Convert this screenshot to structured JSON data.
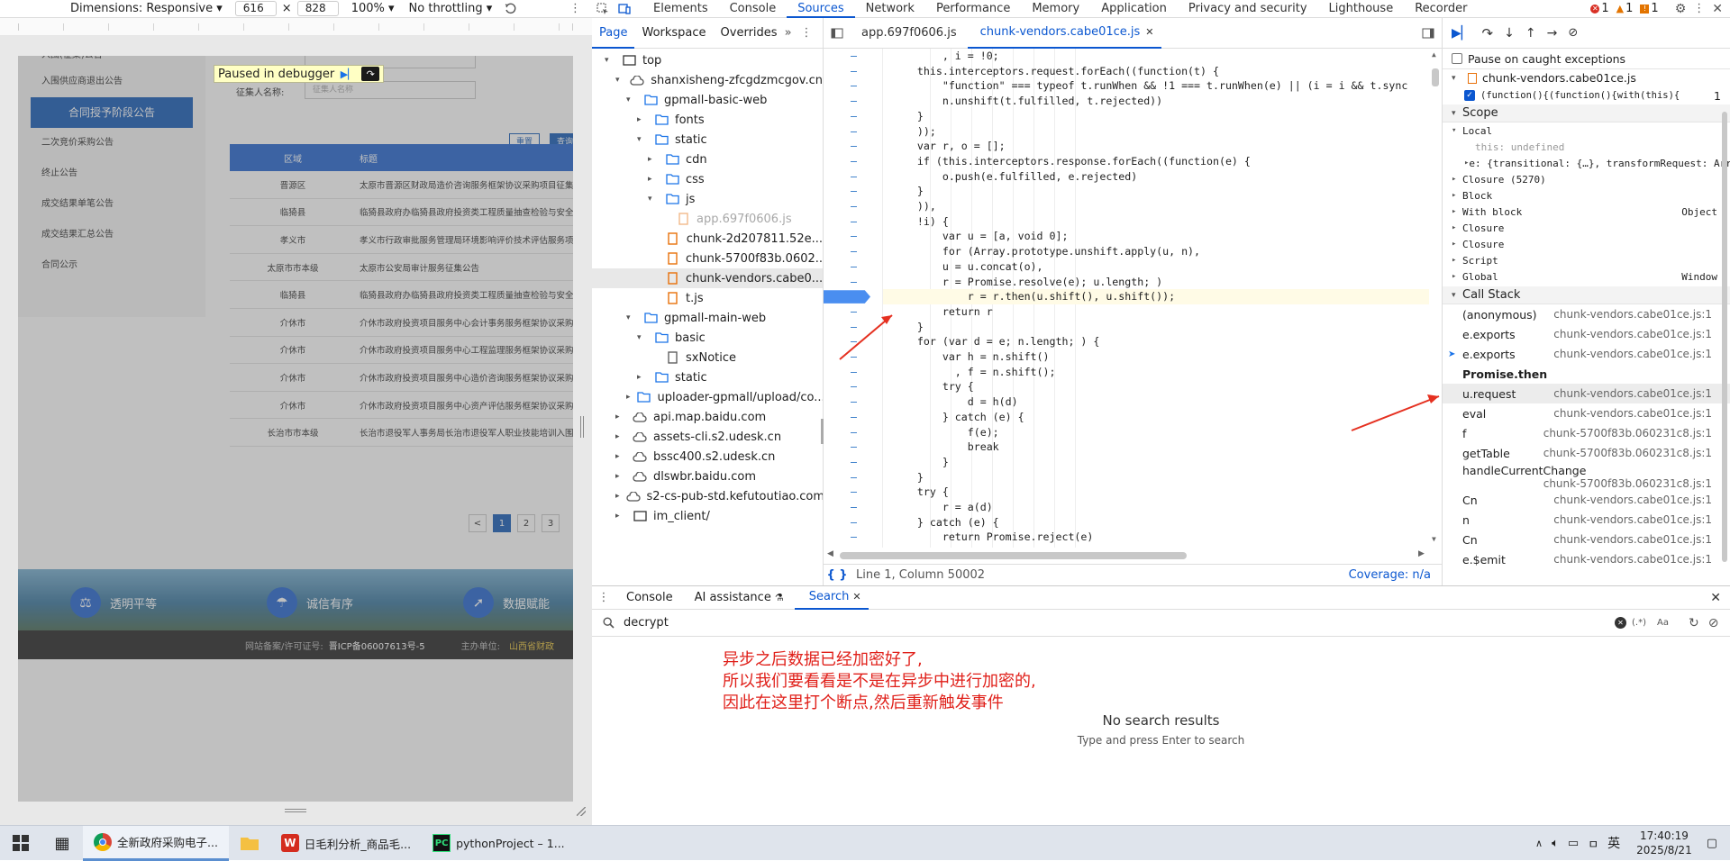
{
  "device_toolbar": {
    "dimensions_label": "Dimensions: Responsive ▾",
    "width": "616",
    "times": "×",
    "height": "828",
    "zoom": "100% ▾",
    "throttle": "No throttling ▾"
  },
  "page": {
    "paused_label": "Paused in debugger",
    "form_label": "征集人名称:",
    "form_placeholder": "征集人名称",
    "reset_btn": "重置",
    "search_btn": "查询",
    "menu": [
      "入围供应商退出公告",
      "合同授予阶段公告",
      "二次竞价采购公告",
      "终止公告",
      "成交结果单笔公告",
      "成交结果汇总公告",
      "合同公示"
    ],
    "menu_active_index": 1,
    "menu_top_partial": "入围(征集)公告",
    "table_head": {
      "region": "区域",
      "title": "标题"
    },
    "table_rows": [
      {
        "region": "晋源区",
        "title": "太原市晋源区财政局造价咨询服务框架协议采购项目征集"
      },
      {
        "region": "临猗县",
        "title": "临猗县政府办临猗县政府投资类工程质量抽查检验与安全"
      },
      {
        "region": "孝义市",
        "title": "孝义市行政审批服务管理局环境影响评价技术评估服务项"
      },
      {
        "region": "太原市市本级",
        "title": "太原市公安局审计服务征集公告"
      },
      {
        "region": "临猗县",
        "title": "临猗县政府办临猗县政府投资类工程质量抽查检验与安全"
      },
      {
        "region": "介休市",
        "title": "介休市政府投资项目服务中心会计事务服务框架协议采购"
      },
      {
        "region": "介休市",
        "title": "介休市政府投资项目服务中心工程监理服务框架协议采购"
      },
      {
        "region": "介休市",
        "title": "介休市政府投资项目服务中心造价咨询服务框架协议采购"
      },
      {
        "region": "介休市",
        "title": "介休市政府投资项目服务中心资产评估服务框架协议采购"
      },
      {
        "region": "长治市市本级",
        "title": "长治市退役军人事务局长治市退役军人职业技能培训入围"
      }
    ],
    "pager": [
      "<",
      "1",
      "2",
      "3"
    ],
    "pager_active": "1",
    "banner": [
      "透明平等",
      "诚信有序",
      "数据赋能"
    ],
    "footer_record": "网站备案/许可证号:",
    "footer_icp": "晋ICP备06007613号-5",
    "footer_host": "主办单位:",
    "footer_host_name": "山西省财政"
  },
  "devtools": {
    "tabs": [
      "Elements",
      "Console",
      "Sources",
      "Network",
      "Performance",
      "Memory",
      "Application",
      "Privacy and security",
      "Lighthouse",
      "Recorder"
    ],
    "active_tab": "Sources",
    "badges": {
      "errors": "1",
      "warnings": "1",
      "issues": "1"
    },
    "nav_tabs": [
      "Page",
      "Workspace",
      "Overrides"
    ],
    "tree": [
      {
        "depth": 0,
        "arrow": "▾",
        "icon": "frame",
        "label": "top"
      },
      {
        "depth": 1,
        "arrow": "▾",
        "icon": "cloud",
        "label": "shanxisheng-zfcgdzmcgov.cn"
      },
      {
        "depth": 2,
        "arrow": "▾",
        "icon": "folder",
        "label": "gpmall-basic-web"
      },
      {
        "depth": 3,
        "arrow": "▸",
        "icon": "folder",
        "label": "fonts"
      },
      {
        "depth": 3,
        "arrow": "▾",
        "icon": "folder",
        "label": "static"
      },
      {
        "depth": 4,
        "arrow": "▸",
        "icon": "folder",
        "label": "cdn"
      },
      {
        "depth": 4,
        "arrow": "▸",
        "icon": "folder",
        "label": "css"
      },
      {
        "depth": 4,
        "arrow": "▾",
        "icon": "folder",
        "label": "js"
      },
      {
        "depth": 5,
        "arrow": "",
        "icon": "file-dim",
        "label": "app.697f0606.js"
      },
      {
        "depth": 5,
        "arrow": "",
        "icon": "file",
        "label": "chunk-2d207811.52e..."
      },
      {
        "depth": 5,
        "arrow": "",
        "icon": "file",
        "label": "chunk-5700f83b.0602..."
      },
      {
        "depth": 5,
        "arrow": "",
        "icon": "file",
        "label": "chunk-vendors.cabe0..."
      },
      {
        "depth": 4,
        "arrow": "",
        "icon": "file",
        "label": "t.js"
      },
      {
        "depth": 2,
        "arrow": "▾",
        "icon": "folder",
        "label": "gpmall-main-web"
      },
      {
        "depth": 3,
        "arrow": "▾",
        "icon": "folder",
        "label": "basic"
      },
      {
        "depth": 4,
        "arrow": "",
        "icon": "doc",
        "label": "sxNotice"
      },
      {
        "depth": 3,
        "arrow": "▸",
        "icon": "folder",
        "label": "static"
      },
      {
        "depth": 2,
        "arrow": "▸",
        "icon": "folder",
        "label": "uploader-gpmall/upload/co..."
      },
      {
        "depth": 1,
        "arrow": "▸",
        "icon": "cloud",
        "label": "api.map.baidu.com"
      },
      {
        "depth": 1,
        "arrow": "▸",
        "icon": "cloud",
        "label": "assets-cli.s2.udesk.cn"
      },
      {
        "depth": 1,
        "arrow": "▸",
        "icon": "cloud",
        "label": "bssc400.s2.udesk.cn"
      },
      {
        "depth": 1,
        "arrow": "▸",
        "icon": "cloud",
        "label": "dlswbr.baidu.com"
      },
      {
        "depth": 1,
        "arrow": "▸",
        "icon": "cloud",
        "label": "s2-cs-pub-std.kefutoutiao.com"
      },
      {
        "depth": 1,
        "arrow": "▸",
        "icon": "frame",
        "label": "im_client/"
      }
    ],
    "selected_tree_index": 11,
    "editor_tabs": [
      "app.697f0606.js",
      "chunk-vendors.cabe01ce.js"
    ],
    "active_editor_tab": 1,
    "code_lines": [
      "        , i = !0;",
      "    this.interceptors.request.forEach((function(t) {",
      "        \"function\" === typeof t.runWhen && !1 === t.runWhen(e) || (i = i && t.sync",
      "        n.unshift(t.fulfilled, t.rejected))",
      "    }",
      "    ));",
      "    var r, o = [];",
      "    if (this.interceptors.response.forEach((function(e) {",
      "        o.push(e.fulfilled, e.rejected)",
      "    }",
      "    )),",
      "    !i) {",
      "        var u = [a, void 0];",
      "        for (Array.prototype.unshift.apply(u, n),",
      "        u = u.concat(o),",
      "        r = Promise.resolve(e); u.length; )",
      "            r = r.then(u.shift(), u.shift());",
      "        return r",
      "    }",
      "    for (var d = e; n.length; ) {",
      "        var h = n.shift()",
      "          , f = n.shift();",
      "        try {",
      "            d = h(d)",
      "        } catch (e) {",
      "            f(e);",
      "            break",
      "        }",
      "    }",
      "    try {",
      "        r = a(d)",
      "    } catch (e) {",
      "        return Promise.reject(e)"
    ],
    "breakpoint_line_index": 16,
    "status": {
      "position": "Line 1, Column 50002",
      "coverage": "Coverage: n/a"
    },
    "pause_on_caught": "Pause on caught exceptions",
    "breakpoint_file": "chunk-vendors.cabe01ce.js",
    "breakpoint_snippet": "(function(){(function(){with(this){",
    "breakpoint_line_no": "1",
    "scope_title": "Scope",
    "scope_rows": [
      {
        "indent": 0,
        "arrow": "▾",
        "name": "Local",
        "value": ""
      },
      {
        "indent": 1,
        "arrow": "",
        "name": "this: undefined",
        "value": ""
      },
      {
        "indent": 1,
        "arrow": "▸",
        "name": "e: {transitional: {…}, transformRequest: Arra",
        "value": ""
      },
      {
        "indent": 0,
        "arrow": "▸",
        "name": "Closure (5270)",
        "value": ""
      },
      {
        "indent": 0,
        "arrow": "▸",
        "name": "Block",
        "value": ""
      },
      {
        "indent": 0,
        "arrow": "▸",
        "name": "With block",
        "value": "Object"
      },
      {
        "indent": 0,
        "arrow": "▸",
        "name": "Closure",
        "value": ""
      },
      {
        "indent": 0,
        "arrow": "▸",
        "name": "Closure",
        "value": ""
      },
      {
        "indent": 0,
        "arrow": "▸",
        "name": "Script",
        "value": ""
      },
      {
        "indent": 0,
        "arrow": "▸",
        "name": "Global",
        "value": "Window"
      }
    ],
    "callstack_title": "Call Stack",
    "callstack": [
      {
        "fn": "(anonymous)",
        "loc": "chunk-vendors.cabe01ce.js:1"
      },
      {
        "fn": "e.exports",
        "loc": "chunk-vendors.cabe01ce.js:1"
      },
      {
        "fn": "e.exports",
        "loc": "chunk-vendors.cabe01ce.js:1",
        "current": true
      },
      {
        "fn": "Promise.then",
        "loc": "",
        "async": true
      },
      {
        "fn": "u.request",
        "loc": "chunk-vendors.cabe01ce.js:1",
        "highlight": true
      },
      {
        "fn": "eval",
        "loc": "chunk-vendors.cabe01ce.js:1"
      },
      {
        "fn": "f",
        "loc": "chunk-5700f83b.060231c8.js:1"
      },
      {
        "fn": "getTable",
        "loc": "chunk-5700f83b.060231c8.js:1"
      },
      {
        "fn": "handleCurrentChange",
        "loc": "chunk-5700f83b.060231c8.js:1",
        "two_line": true
      },
      {
        "fn": "Cn",
        "loc": "chunk-vendors.cabe01ce.js:1"
      },
      {
        "fn": "n",
        "loc": "chunk-vendors.cabe01ce.js:1"
      },
      {
        "fn": "Cn",
        "loc": "chunk-vendors.cabe01ce.js:1"
      },
      {
        "fn": "e.$emit",
        "loc": "chunk-vendors.cabe01ce.js:1"
      }
    ],
    "drawer_tabs": [
      "Console",
      "AI assistance",
      "Search"
    ],
    "active_drawer_tab": "Search",
    "search_query": "decrypt",
    "search_opts": [
      "(.*)",
      "Aa"
    ],
    "no_results": "No search results",
    "no_results_hint": "Type and press Enter to search",
    "annotation_lines": [
      "异步之后数据已经加密好了,",
      "所以我们要看看是不是在异步中进行加密的,",
      "因此在这里打个断点,然后重新触发事件"
    ],
    "annotation_color": "#e0201a"
  },
  "taskbar": {
    "items": [
      "全新政府采购电子...",
      "日毛利分析_商品毛...",
      "pythonProject – 1..."
    ],
    "lang": "英",
    "time": "17:40:19",
    "date": "2025/8/21"
  }
}
